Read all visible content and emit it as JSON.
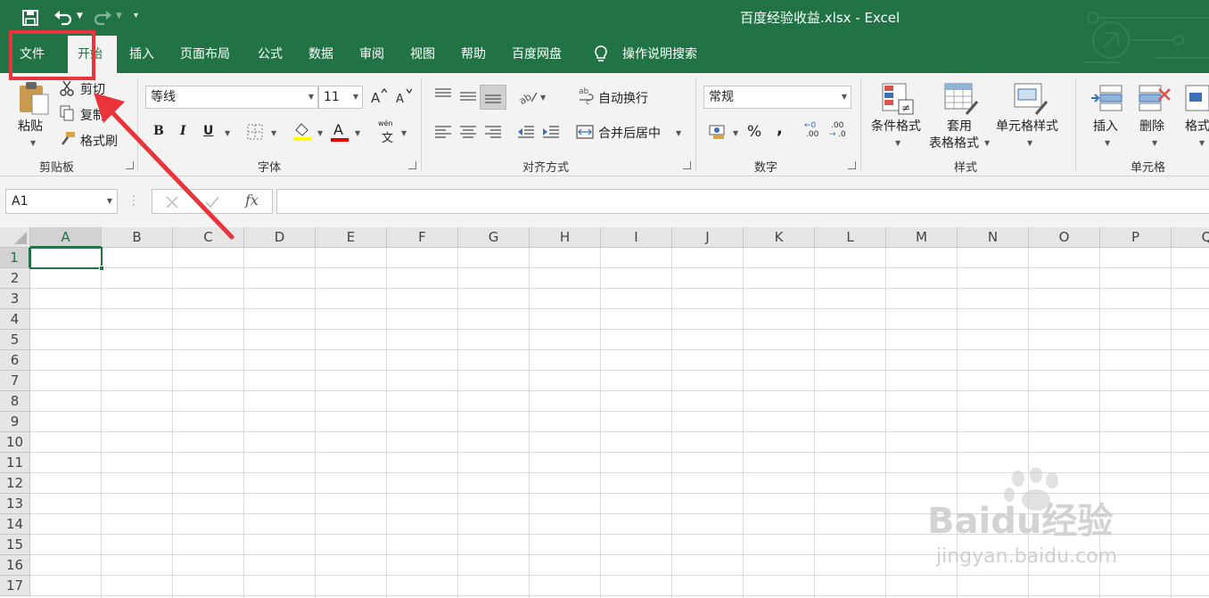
{
  "window": {
    "title": "百度经验收益.xlsx  -  Excel"
  },
  "colors": {
    "brand": "#217346",
    "highlight": "#e8343a"
  },
  "tabs": [
    {
      "label": "文件",
      "active": false
    },
    {
      "label": "开始",
      "active": true
    },
    {
      "label": "插入",
      "active": false
    },
    {
      "label": "页面布局",
      "active": false
    },
    {
      "label": "公式",
      "active": false
    },
    {
      "label": "数据",
      "active": false
    },
    {
      "label": "审阅",
      "active": false
    },
    {
      "label": "视图",
      "active": false
    },
    {
      "label": "帮助",
      "active": false
    },
    {
      "label": "百度网盘",
      "active": false
    }
  ],
  "tell_me": {
    "label": "操作说明搜索",
    "icon": "lightbulb-icon"
  },
  "clipboard": {
    "group_label": "剪贴板",
    "paste": "粘贴",
    "cut": "剪切",
    "copy": "复制",
    "format_painter": "格式刷"
  },
  "font": {
    "group_label": "字体",
    "family": "等线",
    "size": "11",
    "bold": "B",
    "italic": "I",
    "underline": "U",
    "font_color_glyph": "A",
    "phonetic": "wén",
    "phonetic_char": "文"
  },
  "alignment": {
    "group_label": "对齐方式",
    "wrap_text": "自动换行",
    "merge_center": "合并后居中",
    "wrap_icon_text": "ab"
  },
  "number": {
    "group_label": "数字",
    "format": "常规",
    "percent": "%",
    "comma": ",",
    "inc_decimal": ".00",
    "dec_decimal": ".0"
  },
  "styles": {
    "group_label": "样式",
    "conditional": "条件格式",
    "table_format_line1": "套用",
    "table_format_line2": "表格格式",
    "cell_styles": "单元格样式"
  },
  "cells": {
    "group_label": "单元格",
    "insert": "插入",
    "delete": "删除",
    "format": "格式"
  },
  "formula_bar": {
    "name_box": "A1",
    "fx": "fx",
    "value": ""
  },
  "grid": {
    "columns": [
      "A",
      "B",
      "C",
      "D",
      "E",
      "F",
      "G",
      "H",
      "I",
      "J",
      "K",
      "L",
      "M",
      "N",
      "O",
      "P",
      "Q"
    ],
    "rows": [
      "1",
      "2",
      "3",
      "4",
      "5",
      "6",
      "7",
      "8",
      "9",
      "10",
      "11",
      "12",
      "13",
      "14",
      "15",
      "16",
      "17"
    ],
    "active_cell": "A1"
  },
  "watermark": {
    "text": "Baidu经验",
    "url": "jingyan.baidu.com"
  }
}
